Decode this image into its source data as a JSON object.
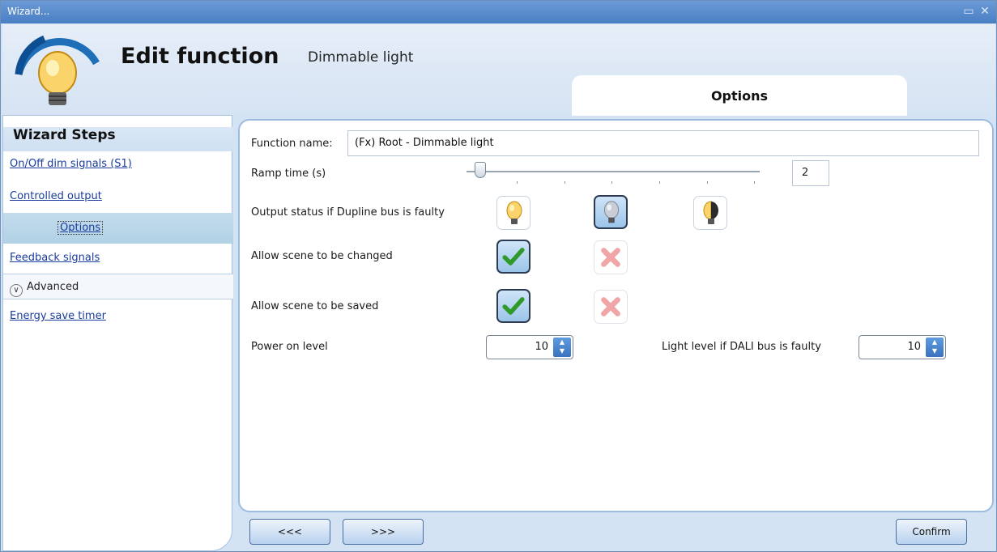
{
  "window": {
    "title": "Wizard..."
  },
  "header": {
    "title": "Edit function",
    "subtitle": "Dimmable light",
    "tab_options": "Options"
  },
  "steps": {
    "heading": "Wizard Steps",
    "items": [
      {
        "label": "On/Off dim signals (S1)",
        "kind": "link"
      },
      {
        "label": "Controlled output",
        "kind": "link"
      },
      {
        "label": "Options",
        "kind": "selected-sub"
      },
      {
        "label": "Feedback signals",
        "kind": "link"
      },
      {
        "label": "Advanced",
        "kind": "group"
      },
      {
        "label": "Energy save timer",
        "kind": "link"
      }
    ]
  },
  "form": {
    "function_name_label": "Function name:",
    "function_name_value": "(Fx) Root - Dimmable light",
    "ramp_time_label": "Ramp time (s)",
    "ramp_time_value": "2",
    "output_status_label": "Output status if Dupline bus is faulty",
    "output_status_options": [
      "bulb-on-icon",
      "bulb-off-icon",
      "bulb-half-icon"
    ],
    "output_status_selected": 1,
    "allow_change_label": "Allow scene to be changed",
    "allow_change_value": true,
    "allow_save_label": "Allow scene to be saved",
    "allow_save_value": true,
    "power_on_label": "Power on level",
    "power_on_value": "10",
    "dali_faulty_label": "Light level if DALI bus is faulty",
    "dali_faulty_value": "10"
  },
  "footer": {
    "prev_label": "<<<",
    "next_label": ">>>",
    "confirm_label": "Confirm"
  },
  "colors": {
    "accent": "#3a72bf",
    "title_bar": "#5a8bcd",
    "link": "#1a3c9c",
    "selected_step": "#b8d4e8"
  }
}
